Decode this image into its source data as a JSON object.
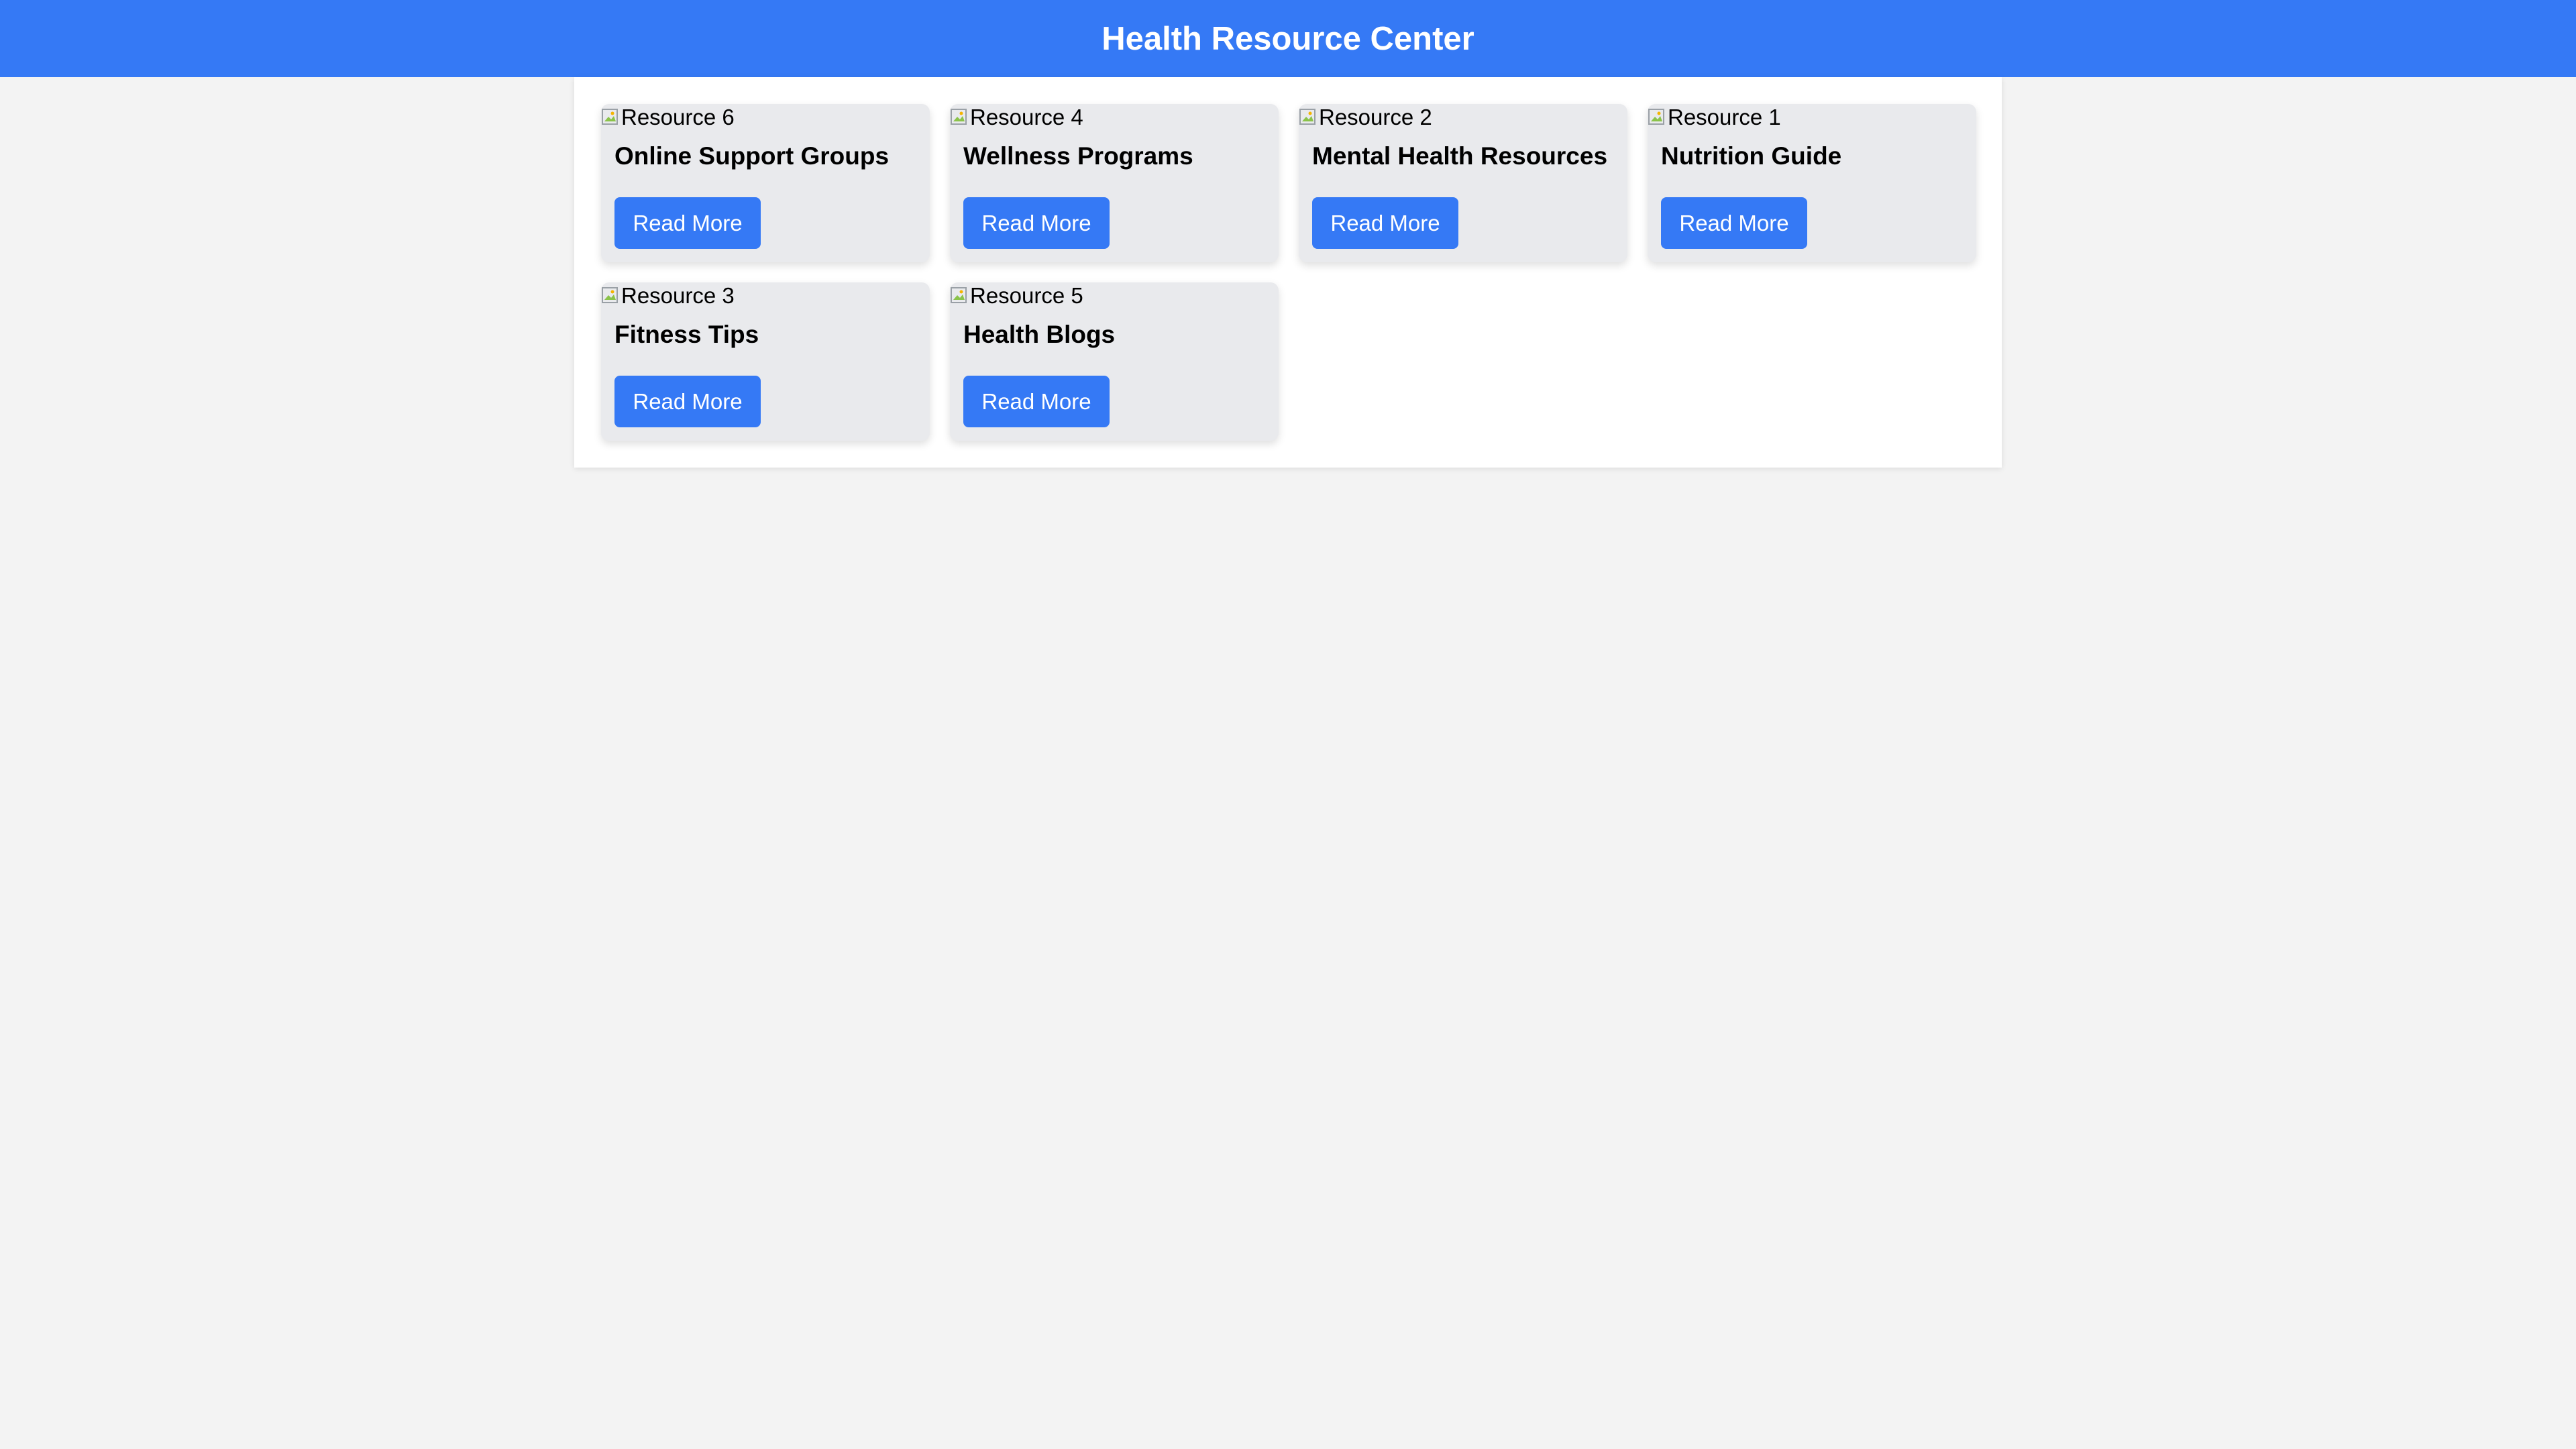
{
  "header": {
    "title": "Health Resource Center"
  },
  "theme": {
    "accent": "#3579f5",
    "page_bg": "#f3f3f3",
    "card_bg": "#e9eaed"
  },
  "resources": [
    {
      "image_alt": "Resource 6",
      "title": "Online Support Groups",
      "button_label": "Read More"
    },
    {
      "image_alt": "Resource 4",
      "title": "Wellness Programs",
      "button_label": "Read More"
    },
    {
      "image_alt": "Resource 2",
      "title": "Mental Health Resources",
      "button_label": "Read More"
    },
    {
      "image_alt": "Resource 1",
      "title": "Nutrition Guide",
      "button_label": "Read More"
    },
    {
      "image_alt": "Resource 3",
      "title": "Fitness Tips",
      "button_label": "Read More"
    },
    {
      "image_alt": "Resource 5",
      "title": "Health Blogs",
      "button_label": "Read More"
    }
  ]
}
